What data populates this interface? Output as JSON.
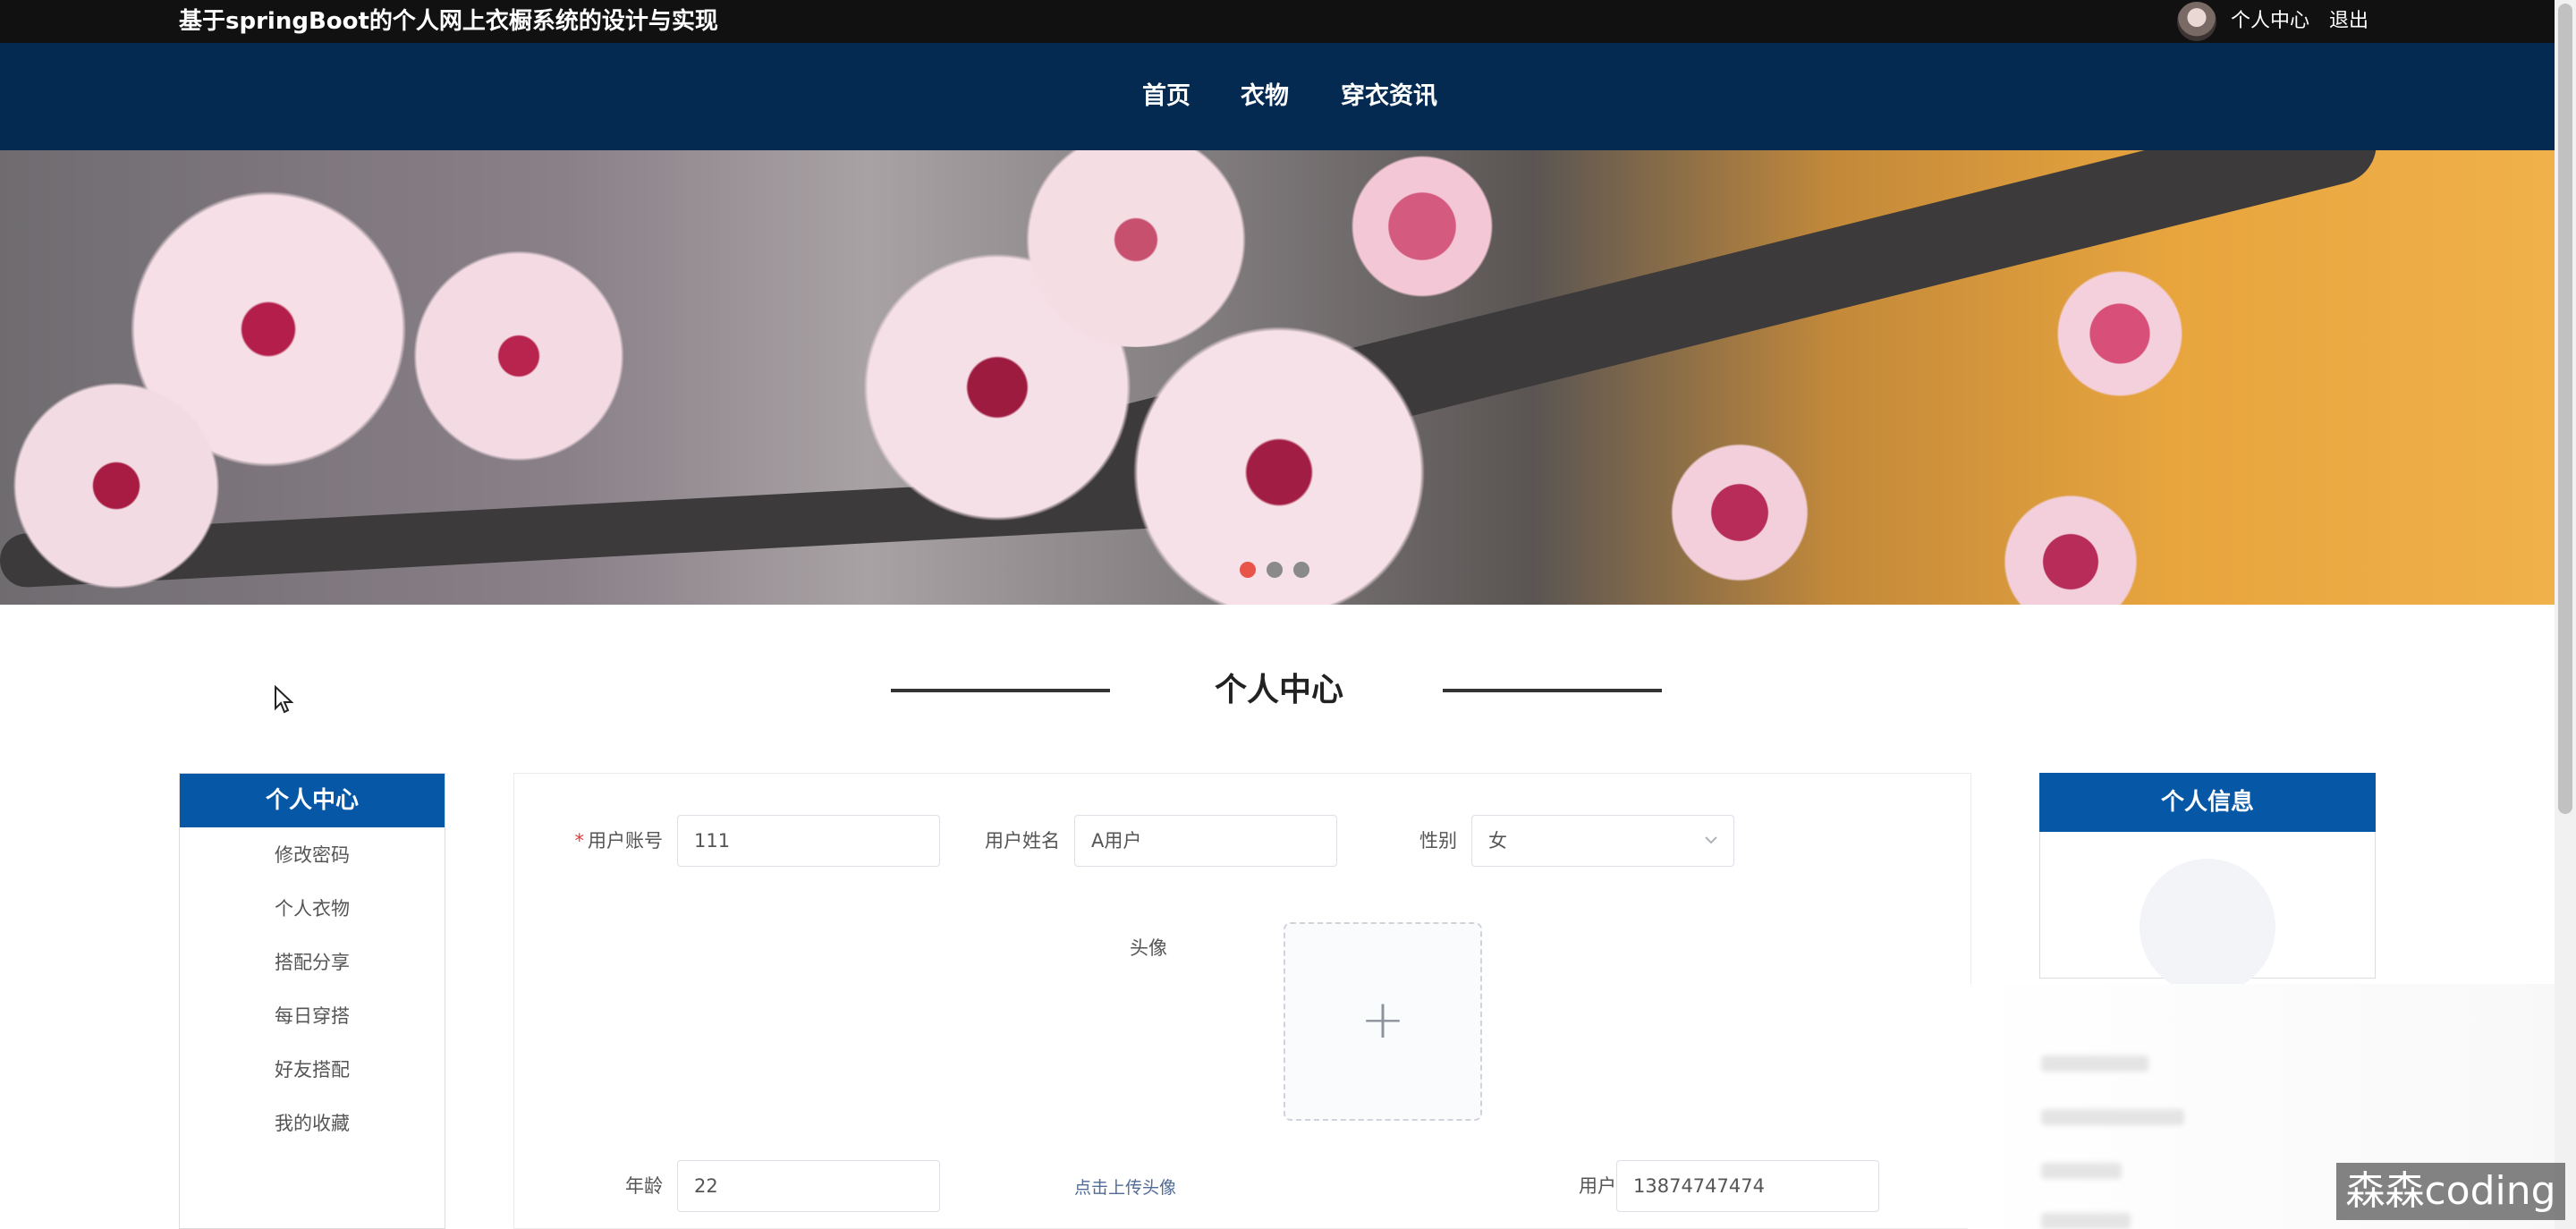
{
  "header": {
    "site_title": "基于springBoot的个人网上衣橱系统的设计与实现",
    "personal_center": "个人中心",
    "logout": "退出"
  },
  "nav": {
    "items": [
      "首页",
      "衣物",
      "穿衣资讯"
    ]
  },
  "banner": {
    "slide_count": 3,
    "active_index": 0
  },
  "section": {
    "title": "个人中心"
  },
  "sidebar": {
    "title": "个人中心",
    "items": [
      "修改密码",
      "个人衣物",
      "搭配分享",
      "每日穿搭",
      "好友搭配",
      "我的收藏"
    ]
  },
  "form": {
    "account_label": "用户账号",
    "account_required_mark": "*",
    "account_value": "111",
    "name_label": "用户姓名",
    "name_value": "A用户",
    "gender_label": "性别",
    "gender_value": "女",
    "avatar_label": "头像",
    "upload_plus": "+",
    "upload_hint": "点击上传头像",
    "age_label": "年龄",
    "age_value": "22",
    "phone_label": "用户手机",
    "phone_value": "13874747474"
  },
  "info_card": {
    "title": "个人信息"
  },
  "watermark": "森森coding",
  "colors": {
    "topbar": "#111111",
    "nav": "#052a52",
    "accent_blue": "#0658a7",
    "dot_active": "#e8534a"
  }
}
